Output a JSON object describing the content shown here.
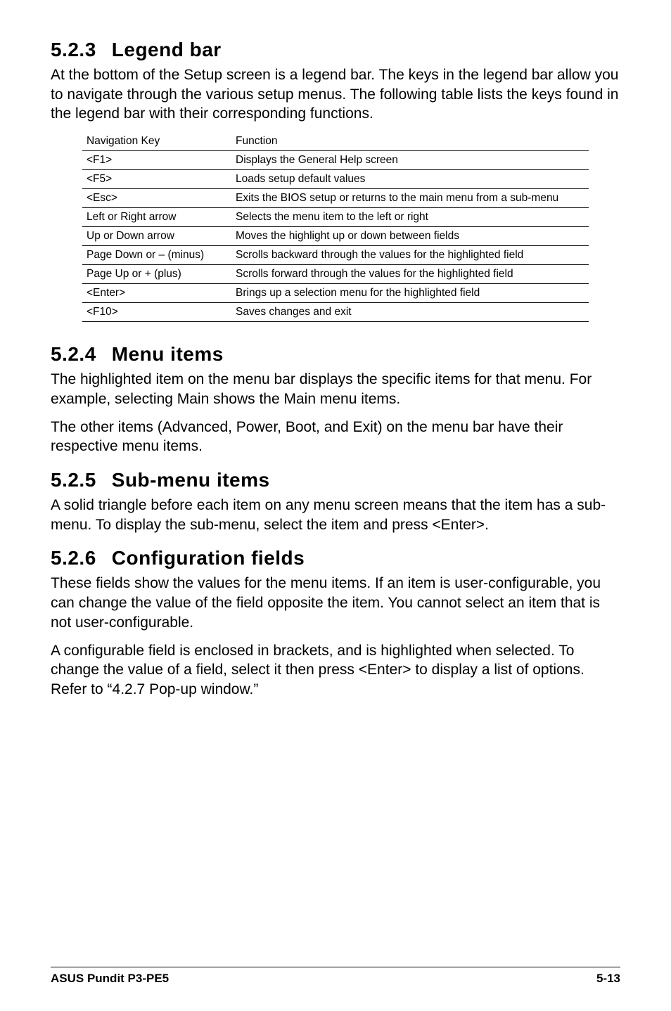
{
  "sections": {
    "s523": {
      "num": "5.2.3",
      "title": "Legend bar",
      "para1": "At the bottom of the Setup screen is a legend bar. The keys in the legend bar allow you to navigate through the various setup menus. The following table lists the keys found in the legend bar with their corresponding functions."
    },
    "table": {
      "head_key": "Navigation Key",
      "head_func": "Function",
      "rows": [
        {
          "key": "<F1>",
          "func": "Displays the General Help screen"
        },
        {
          "key": "<F5>",
          "func": "Loads setup default values"
        },
        {
          "key": "<Esc>",
          "func": "Exits the BIOS setup or returns to the main menu from a sub-menu"
        },
        {
          "key": "Left or Right arrow",
          "func": "Selects the menu item to the left or right"
        },
        {
          "key": "Up or Down arrow",
          "func": "Moves the highlight up or down between fields"
        },
        {
          "key": "Page Down or – (minus)",
          "func": "Scrolls backward through the values for the highlighted field"
        },
        {
          "key": "Page Up or + (plus)",
          "func": "Scrolls forward through the values for the highlighted field"
        },
        {
          "key": "<Enter>",
          "func": "Brings up a selection menu for the highlighted field"
        },
        {
          "key": "<F10>",
          "func": "Saves changes and exit"
        }
      ]
    },
    "s524": {
      "num": "5.2.4",
      "title": "Menu items",
      "para1": "The highlighted item on the menu bar  displays the specific items for that menu. For example, selecting Main shows the Main menu items.",
      "para2": "The other items (Advanced, Power, Boot, and Exit) on the menu bar have their respective menu items."
    },
    "s525": {
      "num": "5.2.5",
      "title": "Sub-menu items",
      "para1": "A solid triangle before each item on any menu screen means that the item has a sub-menu. To display the sub-menu, select the item and press <Enter>."
    },
    "s526": {
      "num": "5.2.6",
      "title": "Configuration fields",
      "para1": "These fields show the values for the menu items. If an item is user-configurable, you can change the value of the field opposite the item. You cannot select an item that is not user-configurable.",
      "para2": "A configurable field is enclosed in brackets, and is highlighted when selected. To change the value of a field, select it then press <Enter> to display a list of options. Refer to “4.2.7 Pop-up window.”"
    }
  },
  "footer": {
    "left": "ASUS Pundit P3-PE5",
    "right": "5-13"
  }
}
